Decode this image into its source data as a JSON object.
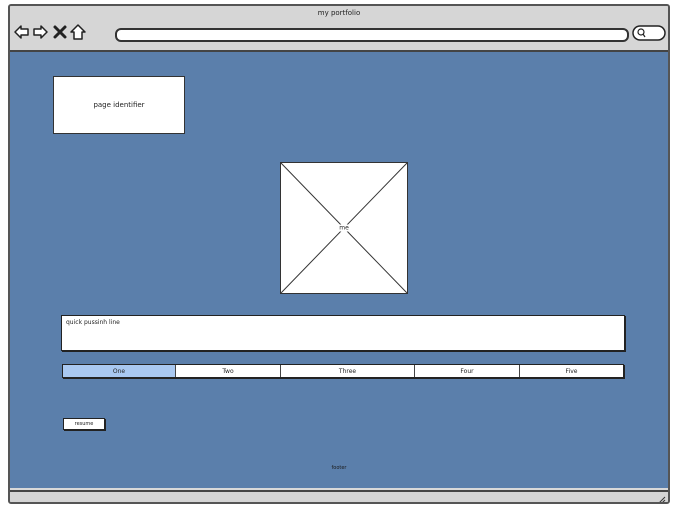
{
  "window": {
    "title": "my portfolio"
  },
  "toolbar": {
    "icons": [
      "back-arrow-icon",
      "forward-arrow-icon",
      "close-x-icon",
      "home-icon"
    ],
    "url_value": "",
    "search_icon": "search-icon"
  },
  "page": {
    "identifier_label": "page identifier",
    "image_label": "me",
    "pitch_text": "quick pussinh line",
    "tabs": [
      {
        "label": "One",
        "active": true
      },
      {
        "label": "Two",
        "active": false
      },
      {
        "label": "Three",
        "active": false
      },
      {
        "label": "Four",
        "active": false
      },
      {
        "label": "Five",
        "active": false
      }
    ],
    "button_label": "resume",
    "footer_text": "footer"
  },
  "colors": {
    "content_background": "#5b7fab",
    "active_tab": "#a9c8f0",
    "chrome": "#d6d6d6"
  }
}
